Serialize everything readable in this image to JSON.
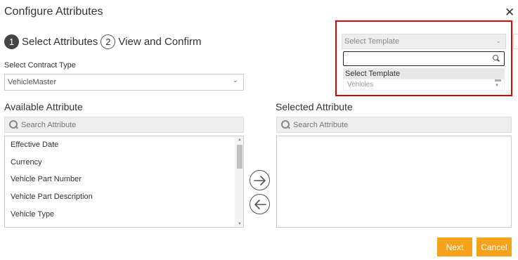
{
  "dialog": {
    "title": "Configure Attributes",
    "close_icon": "close-icon",
    "close_glyph": "✕"
  },
  "steps": [
    {
      "number": "1",
      "label": "Select Attributes",
      "active": true
    },
    {
      "number": "2",
      "label": "View and Confirm",
      "active": false
    }
  ],
  "contract_type": {
    "label": "Select Contract Type",
    "value": "VehicleMaster",
    "chevron": "⌄"
  },
  "available": {
    "heading": "Available Attribute",
    "search_placeholder": "Search Attribute",
    "items": [
      "Effective Date",
      "Currency",
      "Vehicle Part Number",
      "Vehicle Part Description",
      "Vehicle Type"
    ]
  },
  "selected": {
    "heading": "Selected Attribute",
    "search_placeholder": "Search Attribute",
    "items": []
  },
  "template": {
    "placeholder": "Select Template",
    "chevron": "⌄",
    "options": [
      "Select Template",
      "Vehicles"
    ],
    "search_value": ""
  },
  "buttons": {
    "next": "Next",
    "cancel": "Cancel"
  },
  "colors": {
    "accent": "#f7a21b",
    "highlight": "#e00000",
    "step_active": "#444444"
  }
}
